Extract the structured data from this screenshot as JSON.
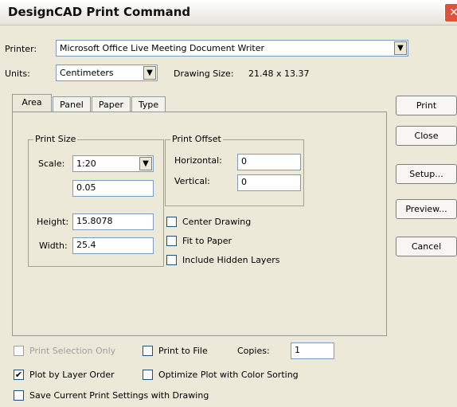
{
  "window": {
    "title": "DesignCAD Print Command"
  },
  "printer": {
    "label": "Printer:",
    "value": "Microsoft Office Live Meeting Document Writer"
  },
  "units": {
    "label": "Units:",
    "value": "Centimeters"
  },
  "drawing_size": {
    "label": "Drawing Size:",
    "value": "21.48 x 13.37"
  },
  "tabs": [
    {
      "label": "Area"
    },
    {
      "label": "Panel"
    },
    {
      "label": "Paper"
    },
    {
      "label": "Type"
    }
  ],
  "print_size": {
    "title": "Print Size",
    "scale_label": "Scale:",
    "scale_value": "1:20",
    "ratio_value": "0.05",
    "height_label": "Height:",
    "height_value": "15.8078",
    "width_label": "Width:",
    "width_value": "25.4"
  },
  "print_offset": {
    "title": "Print Offset",
    "horizontal_label": "Horizontal:",
    "horizontal_value": "0",
    "vertical_label": "Vertical:",
    "vertical_value": "0"
  },
  "options": {
    "center_drawing": "Center Drawing",
    "fit_to_paper": "Fit to Paper",
    "include_hidden_layers": "Include Hidden Layers"
  },
  "buttons": {
    "print": "Print",
    "close": "Close",
    "setup": "Setup...",
    "preview": "Preview...",
    "cancel": "Cancel"
  },
  "bottom": {
    "print_selection_only": "Print Selection Only",
    "print_to_file": "Print to File",
    "copies_label": "Copies:",
    "copies_value": "1",
    "plot_by_layer_order": "Plot by Layer Order",
    "optimize_plot": "Optimize Plot with Color Sorting",
    "save_settings": "Save Current Print Settings with Drawing",
    "plot_by_layer_order_checked": true
  }
}
